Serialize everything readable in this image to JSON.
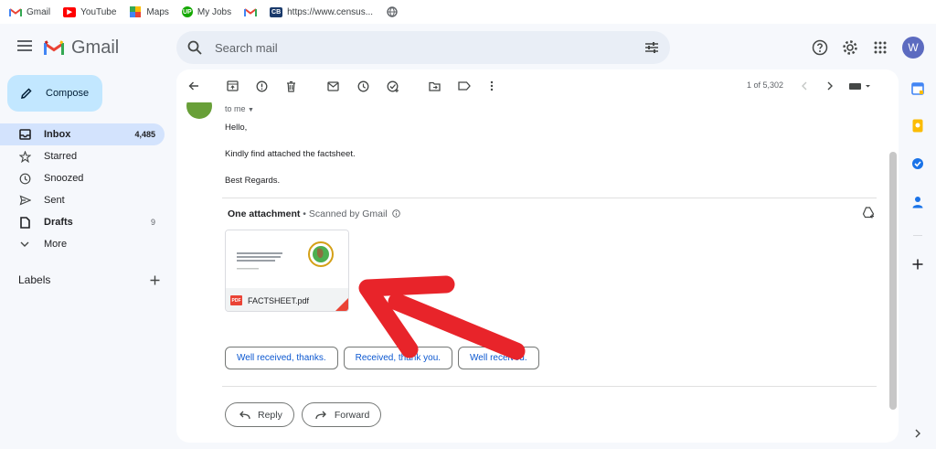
{
  "bookmarks": [
    {
      "label": "Gmail",
      "icon": "gmail-icon"
    },
    {
      "label": "YouTube",
      "icon": "youtube-icon"
    },
    {
      "label": "Maps",
      "icon": "maps-icon"
    },
    {
      "label": "My Jobs",
      "icon": "myjobs-icon",
      "badge": "UP"
    },
    {
      "label": "",
      "icon": "gmail-icon"
    },
    {
      "label": "https://www.census...",
      "icon": "census-icon",
      "badge": "CB"
    },
    {
      "label": "",
      "icon": "globe-icon"
    }
  ],
  "header": {
    "brand": "Gmail",
    "search_placeholder": "Search mail",
    "avatar_letter": "W"
  },
  "sidebar": {
    "compose_label": "Compose",
    "items": [
      {
        "label": "Inbox",
        "count": "4,485",
        "icon": "inbox-icon"
      },
      {
        "label": "Starred",
        "count": "",
        "icon": "star-icon"
      },
      {
        "label": "Snoozed",
        "count": "",
        "icon": "clock-icon"
      },
      {
        "label": "Sent",
        "count": "",
        "icon": "send-icon"
      },
      {
        "label": "Drafts",
        "count": "9",
        "icon": "draft-icon"
      },
      {
        "label": "More",
        "count": "",
        "icon": "chevron-down-icon"
      }
    ],
    "labels_title": "Labels"
  },
  "toolbar": {
    "pager": "1 of 5,302"
  },
  "email": {
    "to_me": "to me",
    "lines": [
      "Hello,",
      "Kindly find attached the factsheet.",
      "Best Regards."
    ],
    "attachment_title": "One attachment",
    "scanned_text": " • Scanned by Gmail",
    "attachment_name": "FACTSHEET.pdf",
    "pdf_badge": "PDF",
    "smart_replies": [
      "Well received, thanks.",
      "Received, thank you.",
      "Well received."
    ],
    "reply_label": "Reply",
    "forward_label": "Forward"
  },
  "colors": {
    "accent": "#0b57d0",
    "compose_bg": "#c2e7ff",
    "active_nav": "#d3e3fd",
    "arrow": "#e8242a"
  }
}
